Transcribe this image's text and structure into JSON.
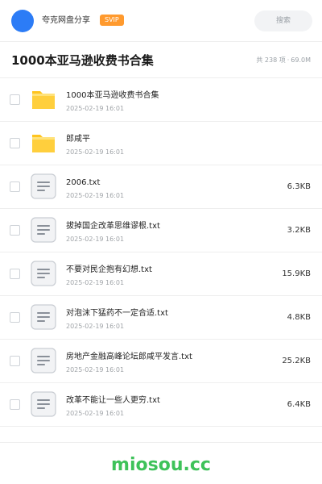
{
  "header": {
    "share_name": "夸克网盘分享",
    "badge": "SVIP",
    "search_placeholder": "搜索"
  },
  "folder": {
    "title": "1000本亚马逊收费书合集",
    "count": "共 238 项",
    "separator": "·",
    "size": "69.0M"
  },
  "files": [
    {
      "name": "1000本亚马逊收费书合集",
      "date": "2025-02-19 16:01",
      "size": "",
      "type": "folder"
    },
    {
      "name": "郎咸平",
      "date": "2025-02-19 16:01",
      "size": "",
      "type": "folder"
    },
    {
      "name": "2006.txt",
      "date": "2025-02-19 16:01",
      "size": "6.3KB",
      "type": "txt"
    },
    {
      "name": "拔掉国企改革思维谬根.txt",
      "date": "2025-02-19 16:01",
      "size": "3.2KB",
      "type": "txt"
    },
    {
      "name": "不要对民企抱有幻想.txt",
      "date": "2025-02-19 16:01",
      "size": "15.9KB",
      "type": "txt"
    },
    {
      "name": "对泡沫下猛药不一定合适.txt",
      "date": "2025-02-19 16:01",
      "size": "4.8KB",
      "type": "txt"
    },
    {
      "name": "房地产金融高峰论坛郎咸平发言.txt",
      "date": "2025-02-19 16:01",
      "size": "25.2KB",
      "type": "txt"
    },
    {
      "name": "改革不能让一些人更穷.txt",
      "date": "2025-02-19 16:01",
      "size": "6.4KB",
      "type": "txt"
    }
  ],
  "footer": {
    "brand": "miosou.cc"
  },
  "colors": {
    "avatar": "#2c7cf6",
    "badge": "#ff9a2e",
    "folder": "#ffc41f",
    "brand": "#3ec25a"
  }
}
